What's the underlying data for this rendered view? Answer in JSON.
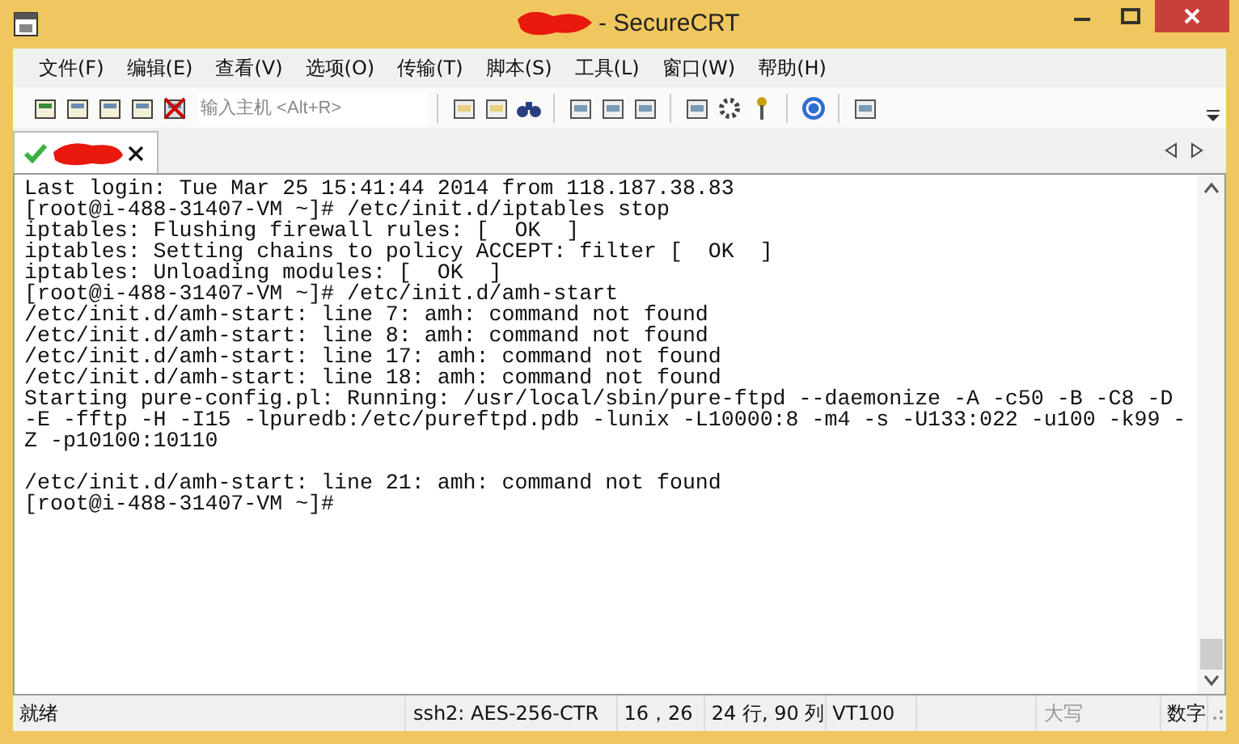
{
  "window": {
    "title": "- SecureCRT"
  },
  "menu": [
    "文件(F)",
    "编辑(E)",
    "查看(V)",
    "选项(O)",
    "传输(T)",
    "脚本(S)",
    "工具(L)",
    "窗口(W)",
    "帮助(H)"
  ],
  "toolbar": {
    "host_field": {
      "placeholder": "输入主机 <Alt+R>"
    }
  },
  "tabs": [
    {
      "connected": true,
      "selected": true
    }
  ],
  "terminal": {
    "lines": [
      {
        "text": "Last login: Tue Mar 25 15:41:44 2014 from 118.187.38.83"
      },
      {
        "text": "[root@i-488-31407-VM ~]# /etc/init.d/iptables stop"
      },
      {
        "text": "iptables: Flushing firewall rules: [  OK  ]"
      },
      {
        "text": "iptables: Setting chains to policy ACCEPT: filter [  OK  ]"
      },
      {
        "text": "iptables: Unloading modules: [  OK  ]"
      },
      {
        "text": "[root@i-488-31407-VM ~]# /etc/init.d/amh-start"
      },
      {
        "text": "/etc/init.d/amh-start: line 7: amh: command not found"
      },
      {
        "text": "/etc/init.d/amh-start: line 8: amh: command not found"
      },
      {
        "text": "/etc/init.d/amh-start: line 17: amh: command not found"
      },
      {
        "text": "/etc/init.d/amh-start: line 18: amh: command not found"
      },
      {
        "text": "Starting pure-config.pl: Running: /usr/local/sbin/pure-ftpd --daemonize -A -c50 -B -C8 -D"
      },
      {
        "text": "-E -fftp -H -I15 -lpuredb:/etc/pureftpd.pdb -lunix -L10000:8 -m4 -s -U133:022 -u100 -k99 -"
      },
      {
        "text": "Z -p10100:10110"
      },
      {
        "text": "/etc/init.d/amh-start: line 21: amh: command not found",
        "gap_before": true
      },
      {
        "text": "[root@i-488-31407-VM ~]#"
      }
    ]
  },
  "status_bar": [
    {
      "text": "就绪",
      "on": true
    },
    {
      "text": "ssh2: AES-256-CTR",
      "on": true
    },
    {
      "text": "16，26",
      "on": true
    },
    {
      "text": "24 行, 90 列",
      "on": true
    },
    {
      "text": "VT100",
      "on": true
    },
    {
      "text": "大写",
      "on": false
    },
    {
      "text": "数字",
      "on": true
    }
  ]
}
